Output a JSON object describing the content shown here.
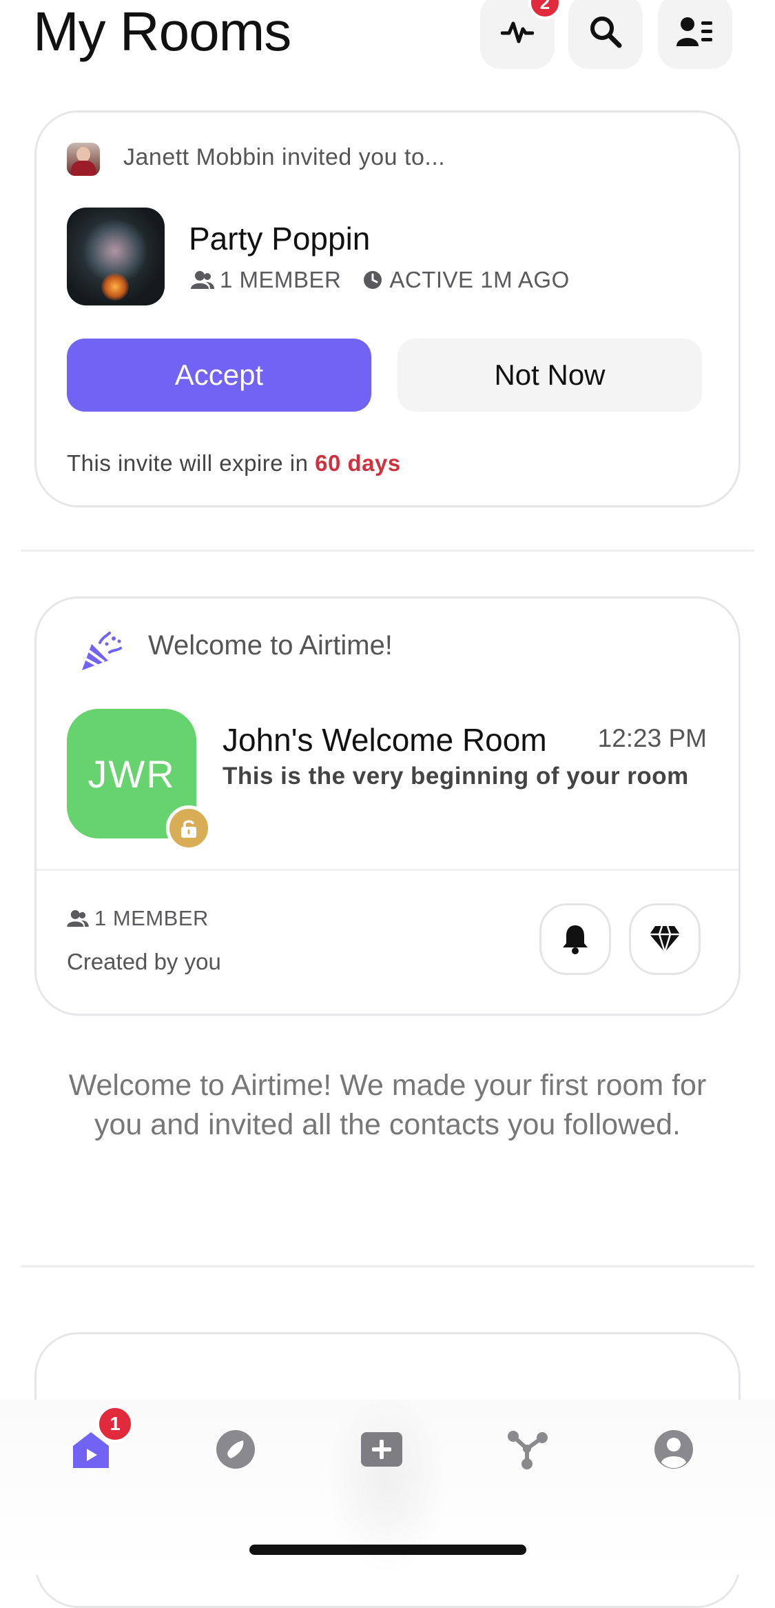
{
  "header": {
    "title": "My Rooms",
    "activity_badge": "2"
  },
  "invite": {
    "inviter_text": "Janett Mobbin invited you to...",
    "room_name": "Party Poppin",
    "members": "1 MEMBER",
    "active": "ACTIVE 1M AGO",
    "accept_label": "Accept",
    "not_now_label": "Not Now",
    "expire_prefix": "This invite will expire in",
    "expire_days": "60 days"
  },
  "welcome_card": {
    "header_text": "Welcome to Airtime!",
    "room_initials": "JWR",
    "room_name": "John's Welcome Room",
    "time": "12:23 PM",
    "preview": "This is the very beginning of your room",
    "members": "1 MEMBER",
    "created_by": "Created by you"
  },
  "welcome_message": "Welcome to Airtime! We made your first room for you and invited all the contacts you followed.",
  "tabbar": {
    "home_badge": "1"
  },
  "colors": {
    "accent": "#7163f3",
    "danger": "#d0313e",
    "room_green": "#67d36f",
    "lock_gold": "#d8ad55"
  },
  "icons": [
    "activity-icon",
    "search-icon",
    "contacts-icon",
    "members-icon",
    "clock-icon",
    "party-popper-icon",
    "lock-icon",
    "bell-icon",
    "diamond-icon",
    "home-icon",
    "compass-icon",
    "add-room-icon",
    "network-icon",
    "profile-icon"
  ]
}
